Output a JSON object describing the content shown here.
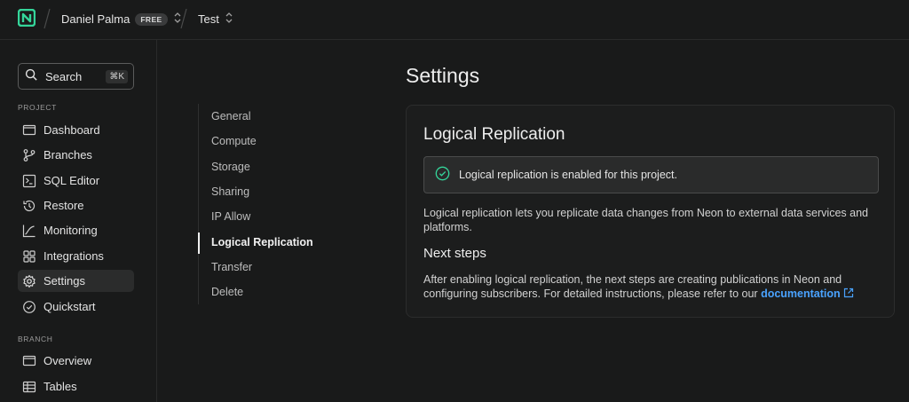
{
  "header": {
    "org_name": "Daniel Palma",
    "plan_badge": "FREE",
    "project_name": "Test"
  },
  "sidebar": {
    "search_label": "Search",
    "search_shortcut": "⌘K",
    "project_section": "PROJECT",
    "project_items": [
      {
        "label": "Dashboard",
        "icon": "dashboard-icon"
      },
      {
        "label": "Branches",
        "icon": "branches-icon"
      },
      {
        "label": "SQL Editor",
        "icon": "sql-editor-icon"
      },
      {
        "label": "Restore",
        "icon": "restore-icon"
      },
      {
        "label": "Monitoring",
        "icon": "monitoring-icon"
      },
      {
        "label": "Integrations",
        "icon": "integrations-icon"
      },
      {
        "label": "Settings",
        "icon": "settings-icon",
        "active": true
      },
      {
        "label": "Quickstart",
        "icon": "quickstart-icon"
      }
    ],
    "branch_section": "BRANCH",
    "branch_items": [
      {
        "label": "Overview",
        "icon": "overview-icon"
      },
      {
        "label": "Tables",
        "icon": "tables-icon"
      }
    ]
  },
  "settings_nav": {
    "items": [
      "General",
      "Compute",
      "Storage",
      "Sharing",
      "IP Allow",
      "Logical Replication",
      "Transfer",
      "Delete"
    ],
    "active": "Logical Replication"
  },
  "main": {
    "page_title": "Settings",
    "card_title": "Logical Replication",
    "alert_text": "Logical replication is enabled for this project.",
    "description": "Logical replication lets you replicate data changes from Neon to external data services and platforms.",
    "next_steps_title": "Next steps",
    "next_steps_text": "After enabling logical replication, the next steps are creating publications in Neon and configuring subscribers. For detailed instructions, please refer to our",
    "link_text": "documentation"
  },
  "colors": {
    "background": "#191a1a",
    "accent_green": "#34d59a",
    "link_blue": "#4aa3ff"
  }
}
